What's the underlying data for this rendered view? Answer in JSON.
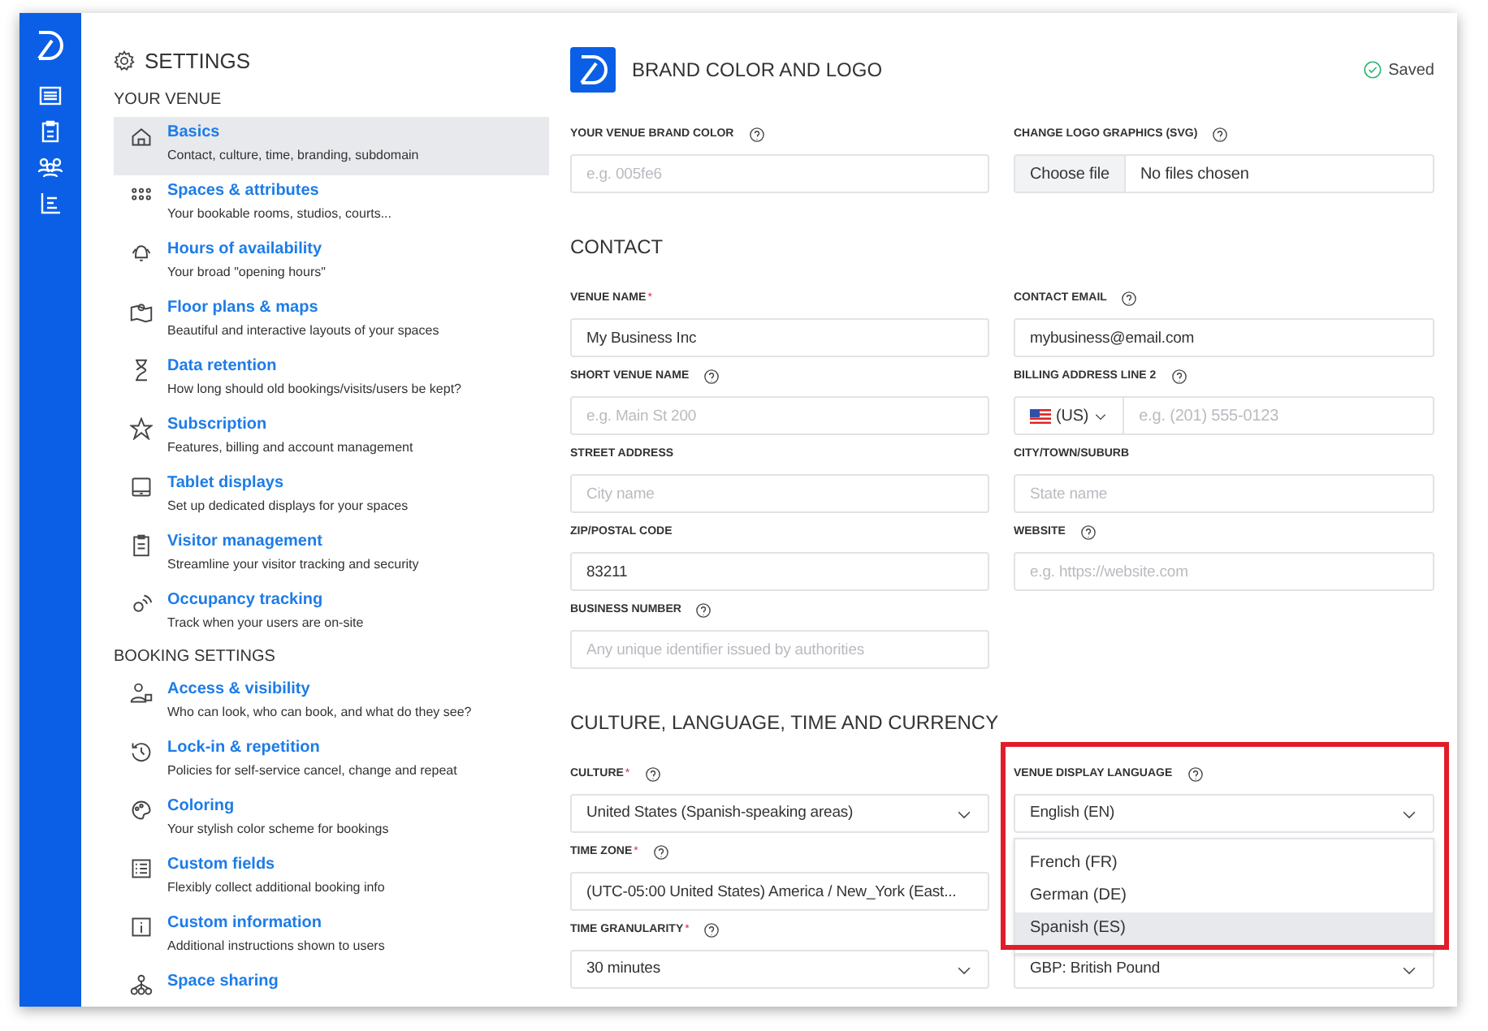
{
  "settings_title": "SETTINGS",
  "sidebar_groups": [
    {
      "title": "YOUR VENUE",
      "items": [
        {
          "title": "Basics",
          "subtitle": "Contact, culture, time, branding, subdomain",
          "selected": true
        },
        {
          "title": "Spaces & attributes",
          "subtitle": "Your bookable rooms, studios, courts...",
          "selected": false
        },
        {
          "title": "Hours of availability",
          "subtitle": "Your broad \"opening hours\"",
          "selected": false
        },
        {
          "title": "Floor plans & maps",
          "subtitle": "Beautiful and interactive layouts of your spaces",
          "selected": false
        },
        {
          "title": "Data retention",
          "subtitle": "How long should old bookings/visits/users be kept?",
          "selected": false
        },
        {
          "title": "Subscription",
          "subtitle": "Features, billing and account management",
          "selected": false
        },
        {
          "title": "Tablet displays",
          "subtitle": "Set up dedicated displays for your spaces",
          "selected": false
        },
        {
          "title": "Visitor management",
          "subtitle": "Streamline your visitor tracking and security",
          "selected": false
        },
        {
          "title": "Occupancy tracking",
          "subtitle": "Track when your users are on-site",
          "selected": false
        }
      ]
    },
    {
      "title": "BOOKING SETTINGS",
      "items": [
        {
          "title": "Access & visibility",
          "subtitle": "Who can look, who can book, and what do they see?",
          "selected": false
        },
        {
          "title": "Lock-in & repetition",
          "subtitle": "Policies for self-service cancel, change and repeat",
          "selected": false
        },
        {
          "title": "Coloring",
          "subtitle": "Your stylish color scheme for bookings",
          "selected": false
        },
        {
          "title": "Custom fields",
          "subtitle": "Flexibly collect additional booking info",
          "selected": false
        },
        {
          "title": "Custom information",
          "subtitle": "Additional instructions shown to users",
          "selected": false
        },
        {
          "title": "Space sharing",
          "selected": false
        }
      ]
    }
  ],
  "header": {
    "title": "BRAND COLOR AND LOGO",
    "status": "Saved"
  },
  "sections": [
    {
      "fields": [
        {
          "kind": "text",
          "label": "YOUR VENUE BRAND COLOR",
          "help": true,
          "placeholder": "e.g. 005fe6"
        },
        {
          "kind": "file",
          "label": "CHANGE LOGO GRAPHICS (SVG)",
          "help": true,
          "button": "Choose file",
          "value": "No files chosen"
        }
      ]
    },
    {
      "title": "CONTACT",
      "fields": [
        {
          "kind": "text",
          "label": "VENUE NAME",
          "required_mark": "*",
          "help": false,
          "value": "My Business Inc"
        },
        {
          "kind": "text",
          "label": "CONTACT EMAIL",
          "help": true,
          "value": "mybusiness@email.com"
        },
        {
          "kind": "text",
          "label": "SHORT VENUE NAME",
          "help": true,
          "placeholder": "e.g. Main St 200"
        },
        {
          "kind": "phone",
          "label": "BILLING ADDRESS LINE 2",
          "help": true,
          "country": "(US)",
          "placeholder": "e.g. (201) 555-0123"
        },
        {
          "kind": "text",
          "label": "STREET ADDRESS",
          "help": false,
          "placeholder": "City name"
        },
        {
          "kind": "text",
          "label": "CITY/TOWN/SUBURB",
          "help": false,
          "placeholder": "State name"
        },
        {
          "kind": "text",
          "label": "ZIP/POSTAL CODE",
          "help": false,
          "value": "83211"
        },
        {
          "kind": "text",
          "label": "WEBSITE",
          "help": true,
          "placeholder": "e.g. https://website.com"
        },
        {
          "kind": "text",
          "label": "BUSINESS NUMBER",
          "help": true,
          "placeholder": "Any unique identifier issued by authorities"
        }
      ]
    },
    {
      "title": "CULTURE, LANGUAGE, TIME AND CURRENCY",
      "fields": [
        {
          "kind": "select",
          "label": "CULTURE",
          "required_mark": "*",
          "help": true,
          "value": "United States (Spanish-speaking areas)"
        },
        {
          "kind": "select",
          "label": "VENUE DISPLAY LANGUAGE",
          "help": true,
          "value": "English (EN)",
          "highlighted": true,
          "expanded": true,
          "options": [
            {
              "label": "French (FR)",
              "hovered": false
            },
            {
              "label": "German (DE)",
              "hovered": false
            },
            {
              "label": "Spanish (ES)",
              "hovered": true
            }
          ]
        },
        {
          "kind": "text",
          "label": "TIME ZONE",
          "required_mark": "*",
          "help": true,
          "value": "(UTC-05:00 United States) America / New_York (East..."
        },
        {
          "kind": "spacer"
        },
        {
          "kind": "select",
          "label": "TIME GRANULARITY",
          "required_mark": "*",
          "help": true,
          "value": "30 minutes"
        },
        {
          "kind": "select",
          "value": "GBP: British Pound"
        }
      ]
    }
  ]
}
